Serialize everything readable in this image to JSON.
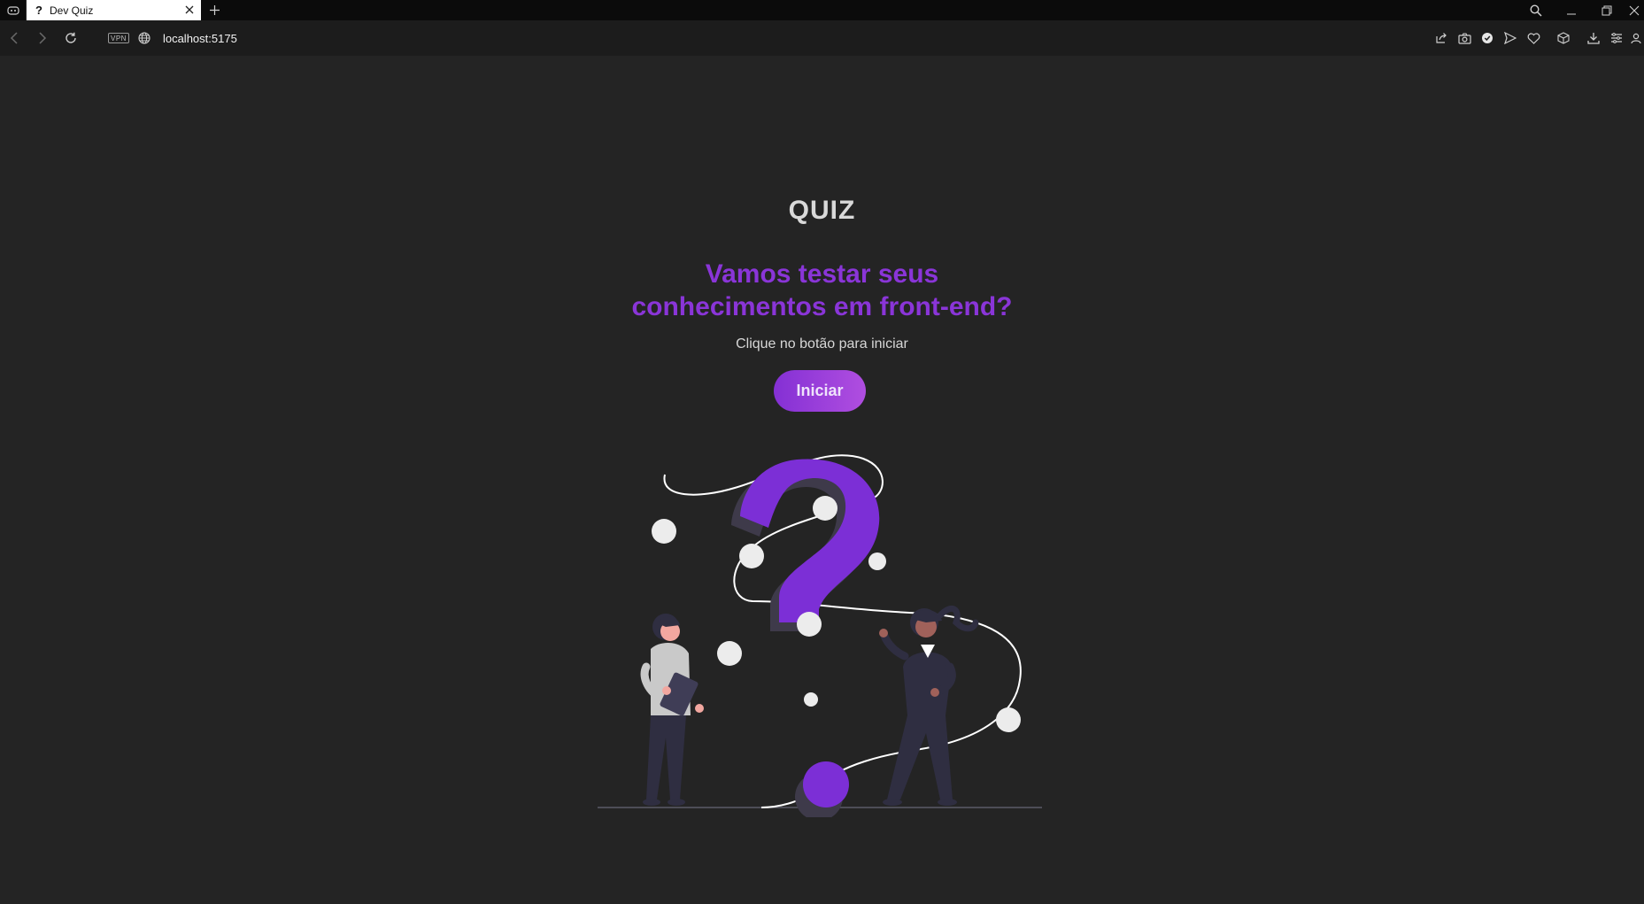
{
  "browser": {
    "tab": {
      "favicon": "?",
      "title": "Dev Quiz"
    },
    "address": {
      "vpn_label": "VPN",
      "url": "localhost:5175"
    },
    "icons": {
      "tabbar": [
        "gamepad-icon",
        "close-icon",
        "new-tab-icon",
        "search-icon",
        "minimize-icon",
        "restore-icon",
        "window-close-icon"
      ],
      "toolbar": [
        "back-icon",
        "forward-icon",
        "reload-icon",
        "globe-icon",
        "share-icon",
        "camera-icon",
        "shield-icon",
        "send-icon",
        "heart-icon",
        "cube-icon",
        "download-icon",
        "menu-icon",
        "profile-icon"
      ]
    }
  },
  "page": {
    "title": "QUIZ",
    "headline_line1": "Vamos testar seus",
    "headline_line2": "conhecimentos em front-end?",
    "subtitle": "Clique no botão para iniciar",
    "start_button": "Iniciar",
    "colors": {
      "background": "#242424",
      "accent": "#8a35d8",
      "button_gradient_start": "#8430d4",
      "button_gradient_end": "#b04ee0"
    }
  }
}
